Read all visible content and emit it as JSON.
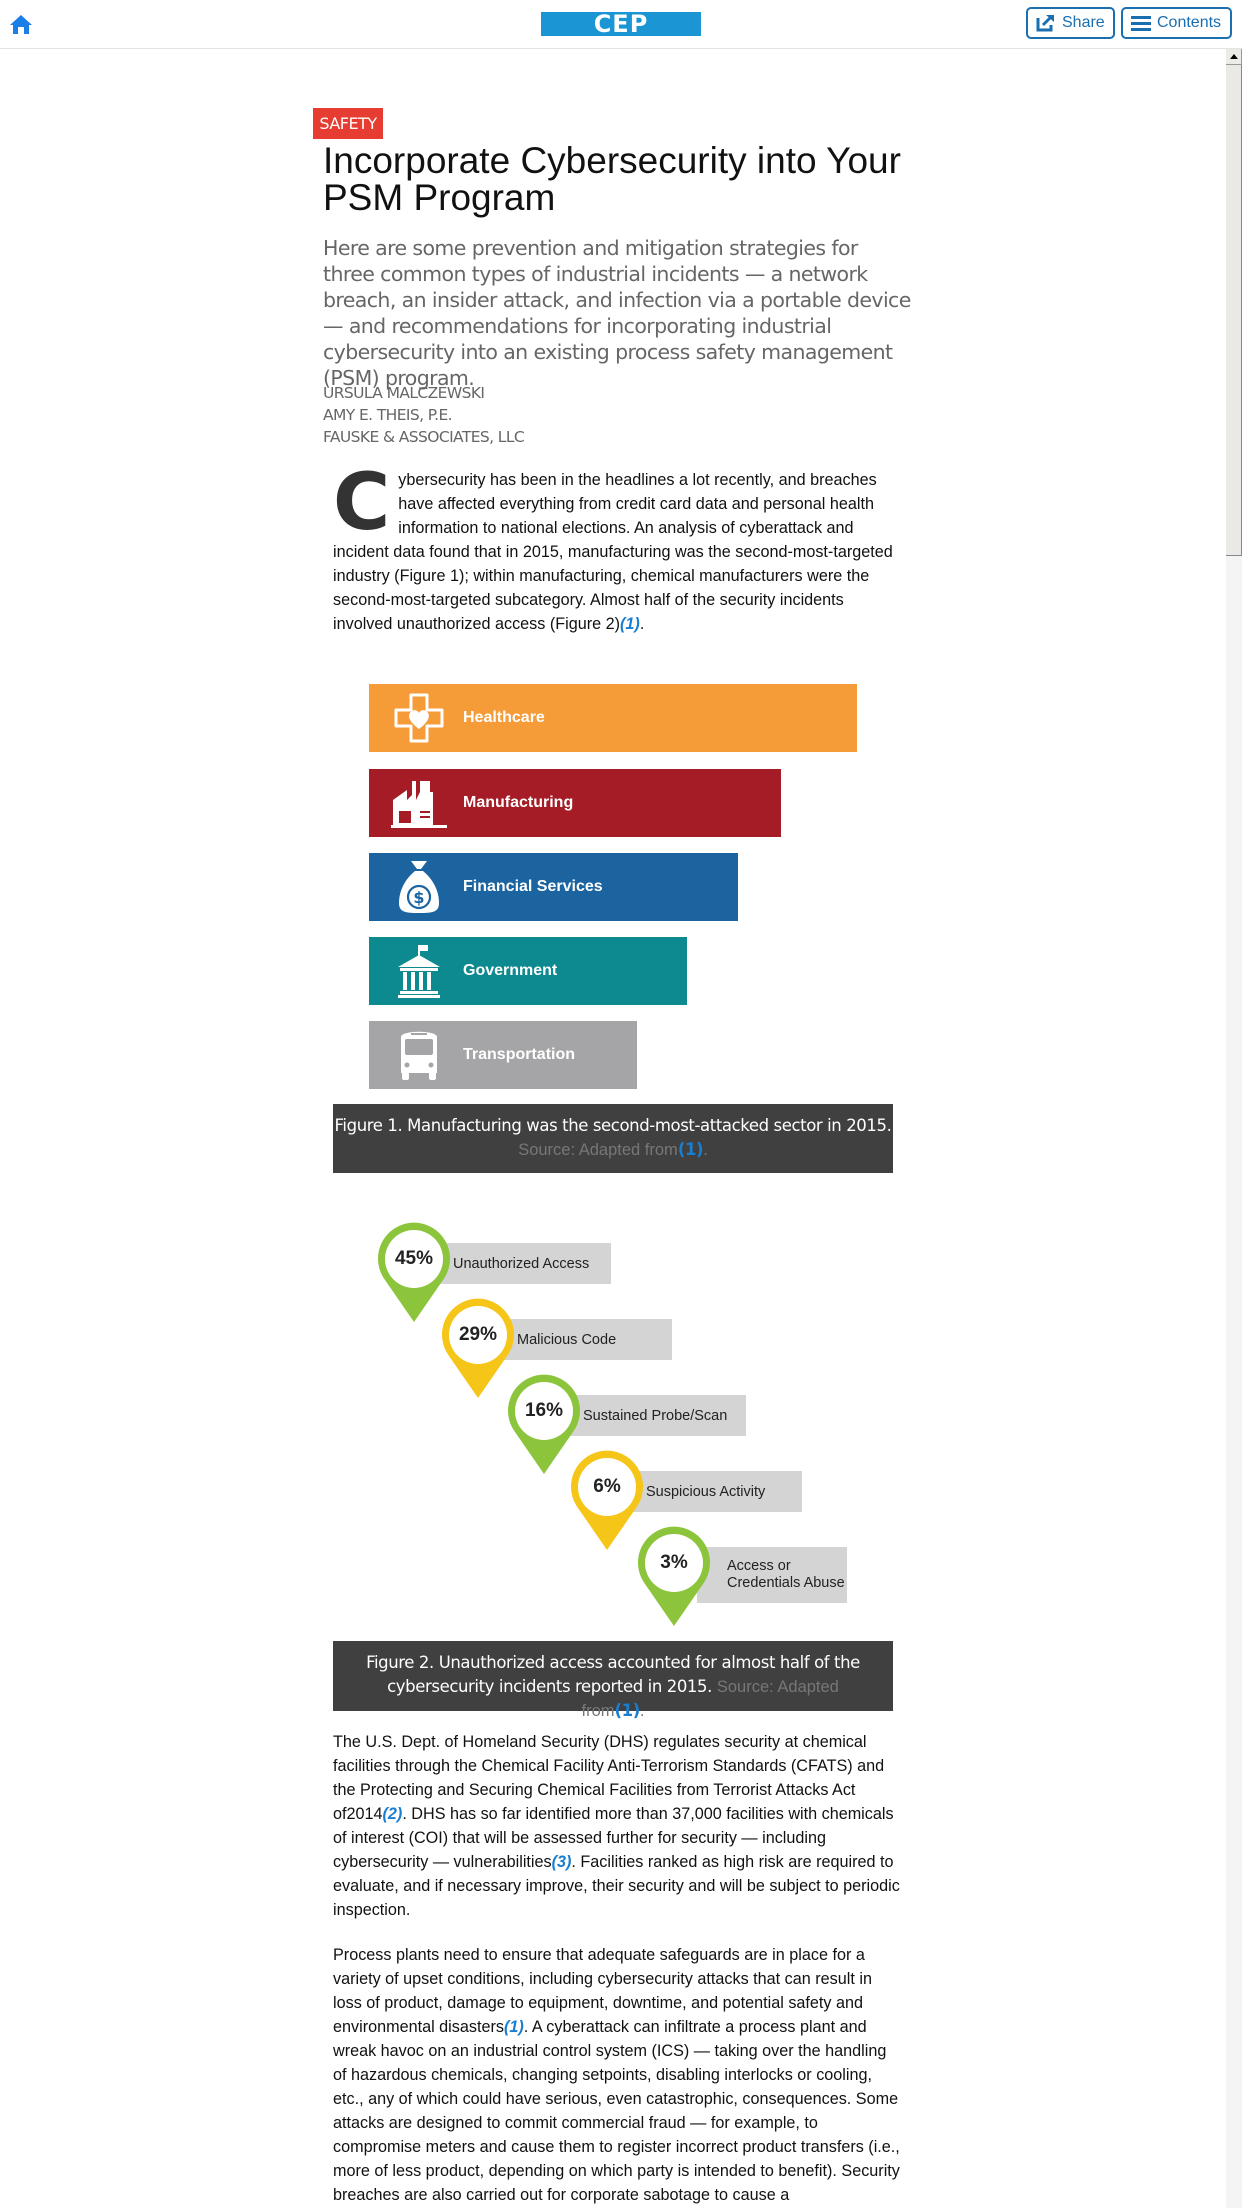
{
  "header": {
    "home_icon": "home-icon",
    "logo": "CEP",
    "share_label": "Share",
    "share_icon": "share-icon",
    "contents_label": "Contents",
    "contents_icon": "menu-icon"
  },
  "article": {
    "section_badge": "SAFETY",
    "title": "Incorporate Cybersecurity into Your PSM Program",
    "deck": "Here are some prevention and mitigation strategies for three common types of industrial incidents — a network breach, an insider attack, and infection via a portable device — and recommendations for incorporating industrial cybersecurity into an existing process safety management (PSM) program.",
    "authors": [
      "URSULA MALCZEWSKI",
      "AMY E. THEIS, P.E.",
      "FAUSKE & ASSOCIATES, LLC"
    ],
    "para1": {
      "dropcap": "C",
      "text": "ybersecurity has been in the headlines a lot recently, and breaches have affected everything from credit card data and personal health information to national elections. An analysis of cyberattack and incident data found that in 2015, manufacturing was the second-most-targeted industry (Figure 1); within manufacturing, chemical manufacturers were the second-most-targeted subcategory. Almost half of the security incidents involved unauthorized access (Figure 2)",
      "ref": "(1)",
      "end": "."
    },
    "figure1": {
      "caption": "Figure 1. Manufacturing was the second-most-attacked sector in 2015.",
      "source": "Source: Adapted from",
      "source_ref": "(1)",
      "source_end": "."
    },
    "figure2": {
      "caption": "Figure 2. Unauthorized access accounted for almost half of the cybersecurity incidents reported in 2015.",
      "source": "Source: Adapted from",
      "source_ref": "(1)",
      "source_end": "."
    },
    "para2": {
      "t1": "The U.S. Dept. of Homeland Security (DHS) regulates security at chemical facilities through the Chemical Facility Anti-Terrorism Standards (CFATS) and the Protecting and Securing Chemical Facilities from Terrorist Attacks Act of2014",
      "r1": "(2)",
      "t2": ". DHS has so far identified more than 37,000 facilities with chemicals of interest (COI) that will be assessed further for security — including cybersecurity — vulnerabilities",
      "r2": "(3)",
      "t3": ". Facilities ranked as high risk are required to evaluate, and if necessary improve, their security and will be subject to periodic inspection."
    },
    "para3": {
      "t1": "Process plants need to ensure that adequate safeguards are in place for a variety of upset conditions, including cybersecurity attacks that can result in loss of product, damage to equipment, downtime, and potential safety and environmental disasters",
      "r1": "(1)",
      "t2": ". A cyberattack can infiltrate a process plant and wreak havoc on an industrial control system (ICS) — taking over the handling of hazardous chemicals, changing setpoints, disabling interlocks or cooling, etc., any of which could have serious, even catastrophic, consequences. Some attacks are designed to commit commercial fraud — for example, to compromise meters and cause them to register incorrect product transfers (i.e., more of less product, depending on which party is intended to benefit). Security breaches are also carried out for corporate sabotage to cause a"
    }
  },
  "chart_data": [
    {
      "type": "bar",
      "title": "Figure 1. Manufacturing was the second-most-attacked sector in 2015.",
      "orientation": "horizontal",
      "values_note": "relative bar lengths, no axis shown; Healthcare = 100",
      "categories": [
        "Healthcare",
        "Manufacturing",
        "Financial Services",
        "Government",
        "Transportation"
      ],
      "values": [
        100,
        84.4,
        75.6,
        65.2,
        55.0
      ],
      "icons": [
        "medical-cross-heart-icon",
        "factory-icon",
        "money-bag-icon",
        "government-building-icon",
        "bus-icon"
      ],
      "colors": [
        "#f59c38",
        "#a51c26",
        "#1b64a0",
        "#0c8a8f",
        "#a5a5a7"
      ]
    },
    {
      "type": "table",
      "title": "Figure 2. Unauthorized access accounted for almost half of the cybersecurity incidents reported in 2015.",
      "categories": [
        "Unauthorized Access",
        "Malicious Code",
        "Sustained Probe/Scan",
        "Suspicious Activity",
        "Access or Credentials Abuse"
      ],
      "values": [
        45,
        29,
        16,
        6,
        3
      ],
      "labels": [
        "45%",
        "29%",
        "16%",
        "6%",
        "3%"
      ],
      "colors": [
        "#8cc43c",
        "#f5c518",
        "#8cc43c",
        "#f5c518",
        "#8cc43c"
      ]
    }
  ]
}
